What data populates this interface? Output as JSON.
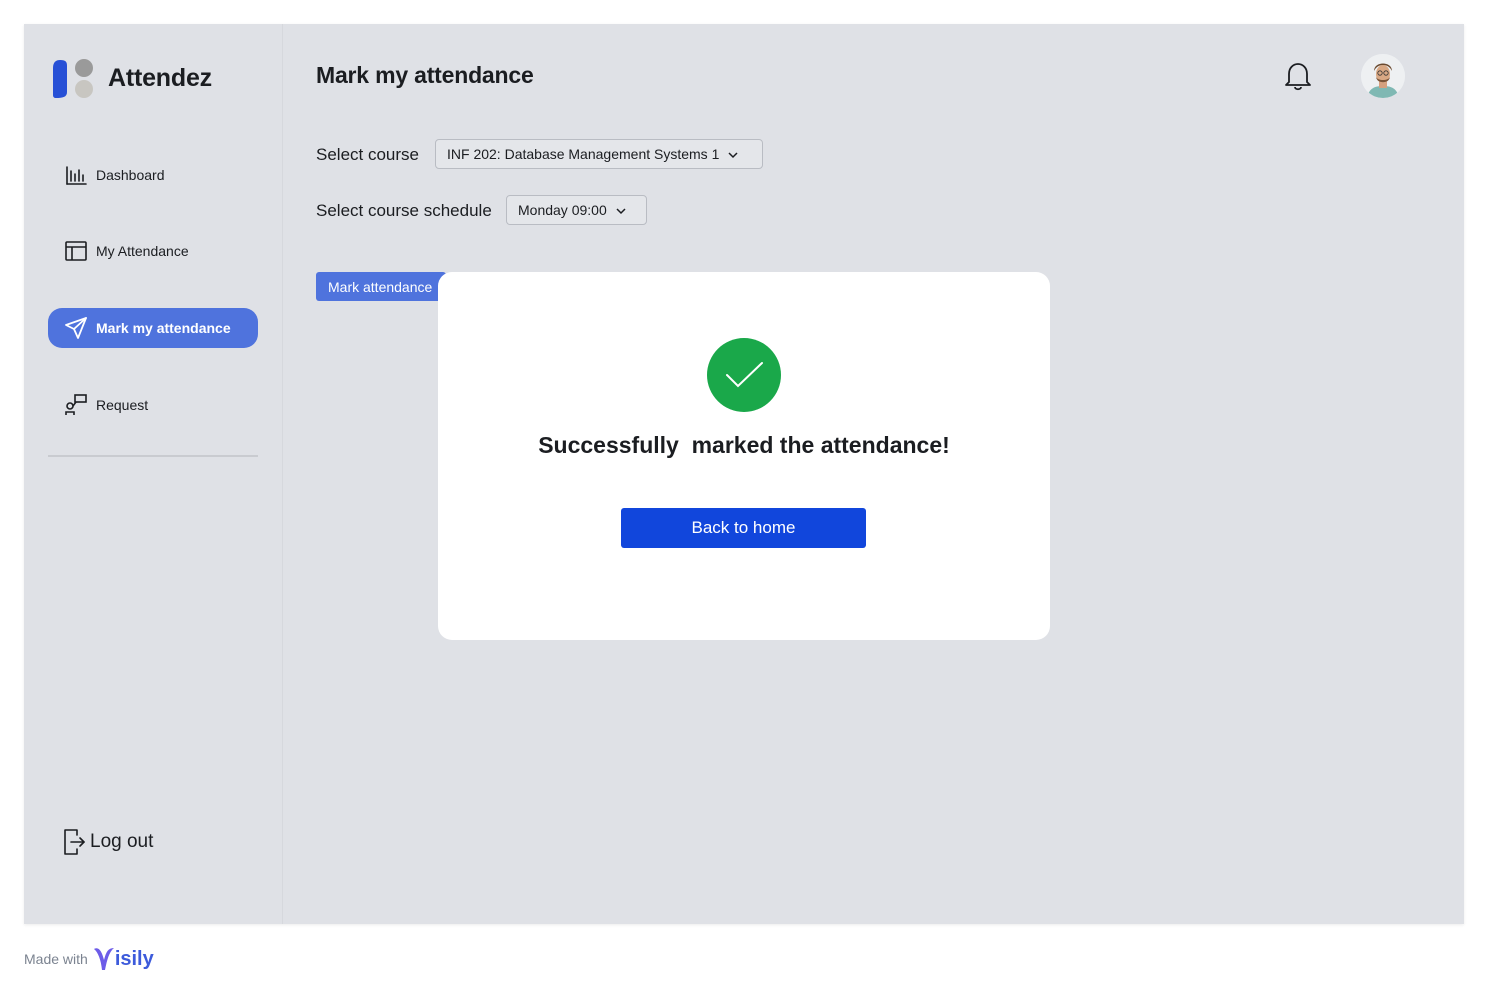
{
  "app": {
    "name": "Attendez"
  },
  "sidebar": {
    "items": [
      {
        "label": "Dashboard",
        "icon": "bar-chart-icon",
        "active": false
      },
      {
        "label": "My Attendance",
        "icon": "calendar-table-icon",
        "active": false
      },
      {
        "label": "Mark my attendance",
        "icon": "send-icon",
        "active": true
      },
      {
        "label": "Request",
        "icon": "request-icon",
        "active": false
      }
    ],
    "logout_label": "Log out"
  },
  "header": {
    "title": "Mark my attendance"
  },
  "form": {
    "course_label": "Select course",
    "course_value": "INF 202: Database Management Systems 1",
    "schedule_label": "Select course schedule",
    "schedule_value": "Monday 09:00",
    "mark_button": "Mark attendance"
  },
  "modal": {
    "message": "Successfully  marked the attendance!",
    "button_label": "Back to home"
  },
  "footer": {
    "made_with": "Made with",
    "brand": "isily"
  },
  "colors": {
    "accent": "#4f73dd",
    "primary_button": "#1146dc",
    "success": "#1aa84a",
    "background": "#dfe1e6"
  }
}
